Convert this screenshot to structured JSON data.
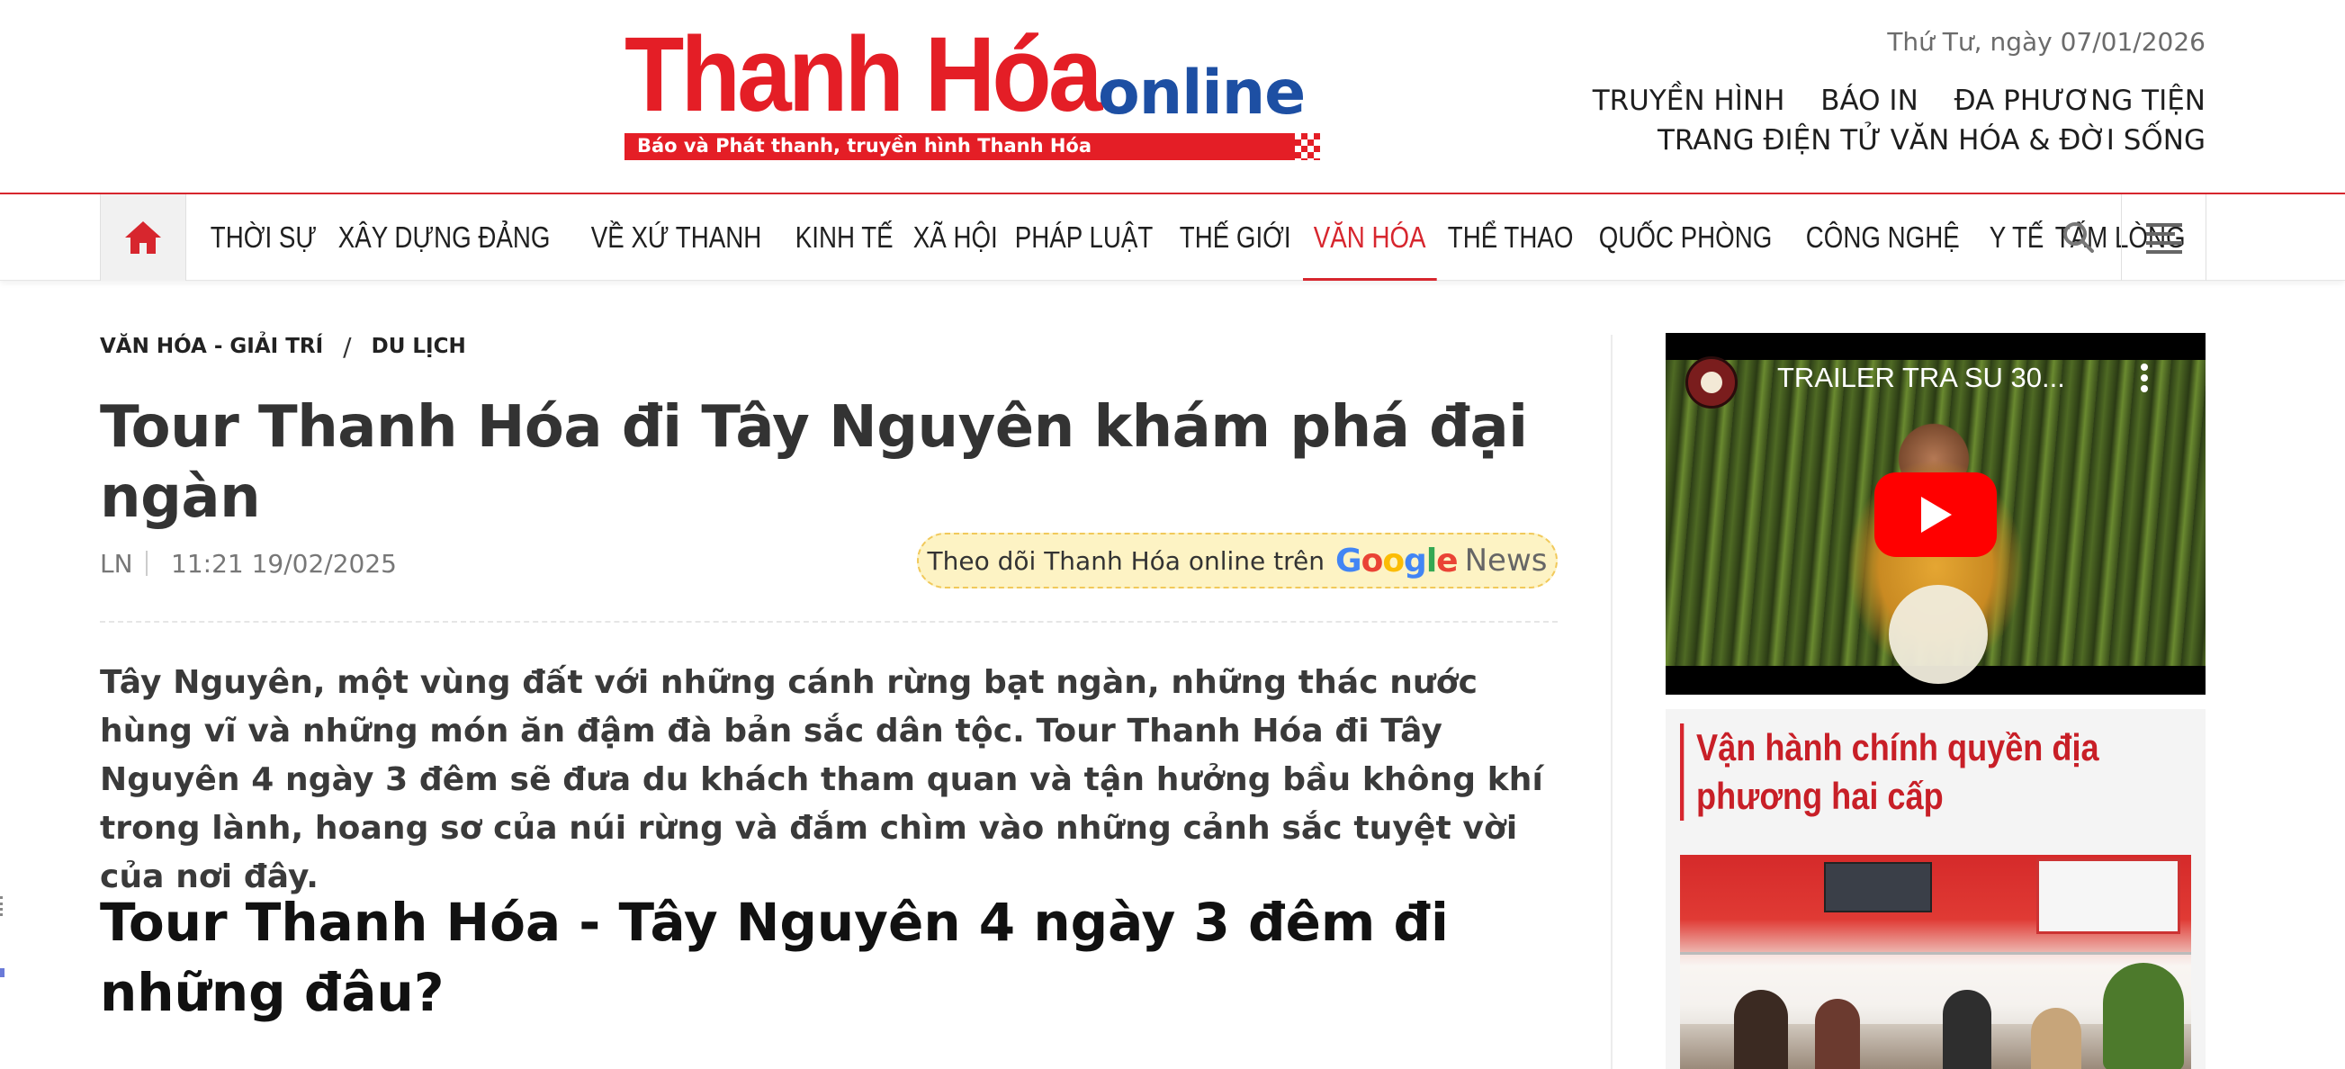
{
  "brand": {
    "logo_main": "Thanh Hóa",
    "logo_online": "online",
    "tagline": "Báo và Phát thanh, truyền hình Thanh Hóa",
    "primary_color": "#e41e26",
    "secondary_color": "#1d4fa3"
  },
  "header": {
    "date": "Thứ Tư, ngày 07/01/2026",
    "links_row1": [
      "TRUYỀN HÌNH",
      "BÁO IN",
      "ĐA PHƯƠNG TIỆN"
    ],
    "links_row2": [
      "TRANG ĐIỆN TỬ VĂN HÓA & ĐỜI SỐNG"
    ]
  },
  "nav": {
    "home_icon": "home-icon",
    "items": [
      "THỜI SỰ",
      "XÂY DỰNG ĐẢNG",
      "VỀ XỨ THANH",
      "KINH TẾ",
      "XÃ HỘI",
      "PHÁP LUẬT",
      "THẾ GIỚI",
      "VĂN HÓA",
      "THỂ THAO",
      "QUỐC PHÒNG",
      "CÔNG NGHỆ",
      "Y TẾ",
      "TẤM LÒNG"
    ],
    "active_item": "VĂN HÓA",
    "search_icon": "search-icon",
    "menu_icon": "menu-icon"
  },
  "article": {
    "breadcrumb": [
      "VĂN HÓA - GIẢI TRÍ",
      "DU LỊCH"
    ],
    "breadcrumb_sep": "/",
    "title": "Tour Thanh Hóa đi Tây Nguyên khám phá đại ngàn",
    "author": "LN",
    "published": "11:21 19/02/2025",
    "google_news_text": "Theo dõi Thanh Hóa online trên",
    "google_word": "Google",
    "news_word": "News",
    "sapo": "Tây Nguyên, một vùng đất với những cánh rừng bạt ngàn, những thác nước hùng vĩ và những món ăn đậm đà bản sắc dân tộc. Tour Thanh Hóa đi Tây Nguyên 4 ngày 3 đêm sẽ đưa du khách tham quan và tận hưởng bầu không khí trong lành, hoang sơ của núi rừng và đắm chìm vào những cảnh sắc tuyệt vời của nơi đây.",
    "subheading": "Tour Thanh Hóa - Tây Nguyên 4 ngày 3 đêm đi những đâu?"
  },
  "sidebar": {
    "video": {
      "title": "TRAILER TRA SU 30...",
      "play_icon": "play-icon",
      "more_icon": "more-vertical-icon"
    },
    "section_title": "Vận hành chính quyền địa phương hai cấp"
  }
}
